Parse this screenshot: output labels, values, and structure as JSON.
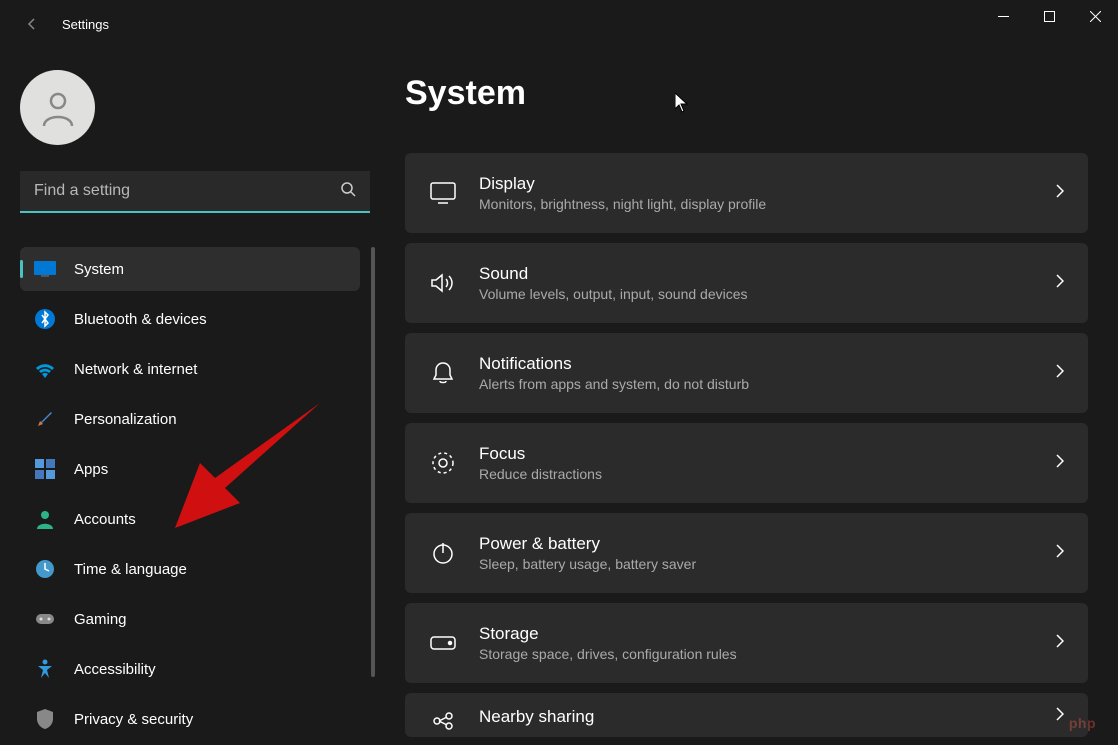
{
  "app_title": "Settings",
  "search": {
    "placeholder": "Find a setting"
  },
  "nav": {
    "items": [
      {
        "label": "System"
      },
      {
        "label": "Bluetooth & devices"
      },
      {
        "label": "Network & internet"
      },
      {
        "label": "Personalization"
      },
      {
        "label": "Apps"
      },
      {
        "label": "Accounts"
      },
      {
        "label": "Time & language"
      },
      {
        "label": "Gaming"
      },
      {
        "label": "Accessibility"
      },
      {
        "label": "Privacy & security"
      }
    ]
  },
  "page_title": "System",
  "settings": [
    {
      "title": "Display",
      "desc": "Monitors, brightness, night light, display profile"
    },
    {
      "title": "Sound",
      "desc": "Volume levels, output, input, sound devices"
    },
    {
      "title": "Notifications",
      "desc": "Alerts from apps and system, do not disturb"
    },
    {
      "title": "Focus",
      "desc": "Reduce distractions"
    },
    {
      "title": "Power & battery",
      "desc": "Sleep, battery usage, battery saver"
    },
    {
      "title": "Storage",
      "desc": "Storage space, drives, configuration rules"
    },
    {
      "title": "Nearby sharing",
      "desc": ""
    }
  ],
  "watermark": "php"
}
